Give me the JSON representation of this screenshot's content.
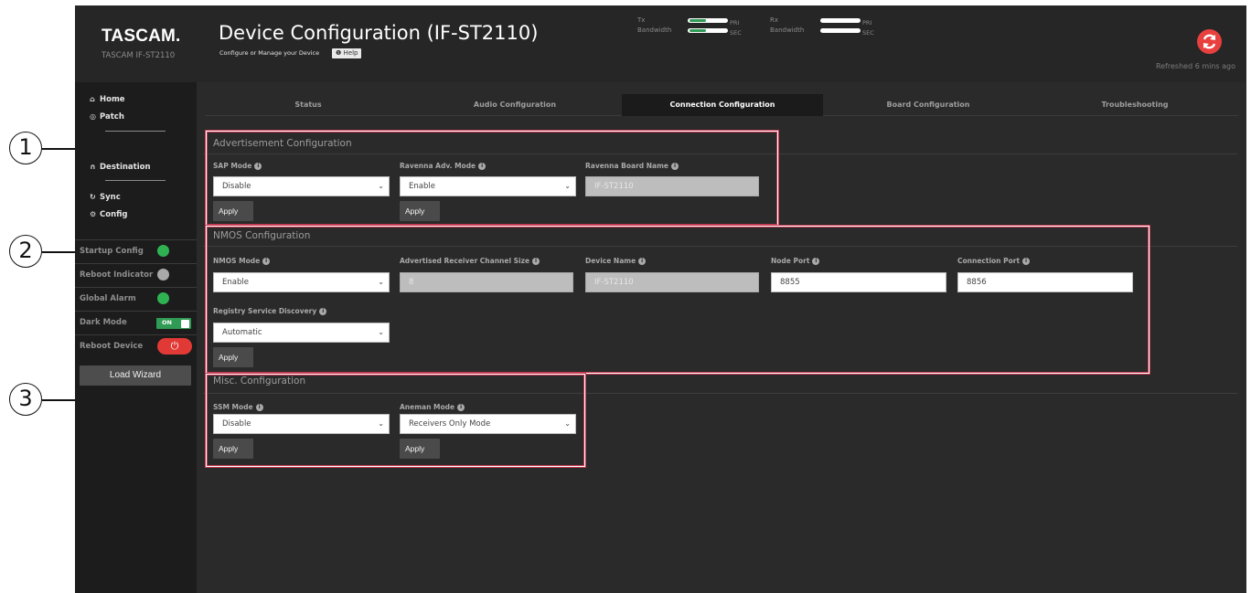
{
  "header": {
    "brand": "TASCAM.",
    "model": "TASCAM IF-ST2110",
    "title": "Device Configuration (IF-ST2110)",
    "subtitle": "Configure or Manage your Device",
    "help_label": "❶ Help",
    "tx_label_1": "Tx",
    "tx_label_2": "Bandwidth",
    "rx_label_1": "Rx",
    "rx_label_2": "Bandwidth",
    "pri_tag": "PRI",
    "sec_tag": "SEC",
    "tx_pri_level": 0.4,
    "tx_sec_level": 0.4,
    "rx_pri_level": 0,
    "rx_sec_level": 0,
    "refreshed": "Refreshed 6 mins ago"
  },
  "sidebar": {
    "home": "Home",
    "patch": "Patch",
    "destination": "Destination",
    "sync": "Sync",
    "config": "Config",
    "startup_config": "Startup Config",
    "reboot_indicator": "Reboot Indicator",
    "global_alarm": "Global Alarm",
    "dark_mode": "Dark Mode",
    "dark_mode_state": "ON",
    "reboot_device": "Reboot Device",
    "load_wizard": "Load Wizard",
    "colors": {
      "startup": "#2fb352",
      "reboot": "#a9a9a9",
      "alarm": "#2fb352"
    }
  },
  "tabs": [
    {
      "label": "Status"
    },
    {
      "label": "Audio Configuration"
    },
    {
      "label": "Connection Configuration"
    },
    {
      "label": "Board Configuration"
    },
    {
      "label": "Troubleshooting"
    }
  ],
  "advertisement": {
    "title": "Advertisement Configuration",
    "sap_label": "SAP Mode",
    "sap_value": "Disable",
    "ravenna_label": "Ravenna Adv. Mode",
    "ravenna_value": "Enable",
    "board_name_label": "Ravenna Board Name",
    "board_name_value": "IF-ST2110",
    "apply": "Apply"
  },
  "nmos": {
    "title": "NMOS Configuration",
    "mode_label": "NMOS Mode",
    "mode_value": "Enable",
    "channel_size_label": "Advertised Receiver Channel Size",
    "channel_size_value": "8",
    "device_name_label": "Device Name",
    "device_name_value": "IF-ST2110",
    "node_port_label": "Node Port",
    "node_port_value": "8855",
    "conn_port_label": "Connection Port",
    "conn_port_value": "8856",
    "registry_label": "Registry Service Discovery",
    "registry_value": "Automatic",
    "apply": "Apply"
  },
  "misc": {
    "title": "Misc. Configuration",
    "ssm_label": "SSM Mode",
    "ssm_value": "Disable",
    "aneman_label": "Aneman Mode",
    "aneman_value": "Receivers Only Mode",
    "apply": "Apply"
  },
  "callouts": [
    "1",
    "2",
    "3"
  ]
}
